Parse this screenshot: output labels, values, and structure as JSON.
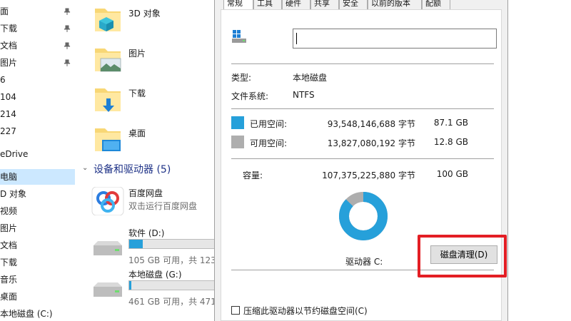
{
  "nav": {
    "items": [
      {
        "label": "面",
        "pinned": true
      },
      {
        "label": "下载",
        "pinned": true
      },
      {
        "label": "文档",
        "pinned": true
      },
      {
        "label": "图片",
        "pinned": true
      },
      {
        "label": "6",
        "pinned": false
      },
      {
        "label": "104",
        "pinned": false
      },
      {
        "label": "214",
        "pinned": false
      },
      {
        "label": "227",
        "pinned": false
      },
      {
        "label": "eDrive",
        "pinned": false
      },
      {
        "label": "电脑",
        "pinned": false,
        "selected": true
      },
      {
        "label": "D 对象",
        "pinned": false
      },
      {
        "label": "视频",
        "pinned": false
      },
      {
        "label": "图片",
        "pinned": false
      },
      {
        "label": "文档",
        "pinned": false
      },
      {
        "label": "下载",
        "pinned": false
      },
      {
        "label": "音乐",
        "pinned": false
      },
      {
        "label": "桌面",
        "pinned": false
      },
      {
        "label": "本地磁盘 (C:)",
        "pinned": false
      }
    ]
  },
  "files": {
    "folders": [
      {
        "label": "3D 对象",
        "icon": "3d-objects-folder-icon"
      },
      {
        "label": "图片",
        "icon": "pictures-folder-icon"
      },
      {
        "label": "下载",
        "icon": "downloads-folder-icon"
      },
      {
        "label": "桌面",
        "icon": "desktop-folder-icon"
      }
    ],
    "group_header": "设备和驱动器 (5)",
    "drives": [
      {
        "name": "百度网盘",
        "sub": "双击运行百度网盘",
        "icon": "baidu-netdisk-icon"
      },
      {
        "name": "软件 (D:)",
        "sub": "105 GB 可用，共 123",
        "usage": 0.15,
        "icon": "hard-drive-icon"
      },
      {
        "name": "本地磁盘 (G:)",
        "sub": "461 GB 可用，共 471",
        "usage": 0.02,
        "icon": "hard-drive-icon"
      }
    ]
  },
  "dialog": {
    "tabs": [
      {
        "label": "常规",
        "active": true
      },
      {
        "label": "工具",
        "active": false
      },
      {
        "label": "硬件",
        "active": false
      },
      {
        "label": "共享",
        "active": false
      },
      {
        "label": "安全",
        "active": false
      },
      {
        "label": "以前的版本",
        "active": false
      },
      {
        "label": "配额",
        "active": false
      }
    ],
    "name_value": "",
    "type_label": "类型:",
    "type_value": "本地磁盘",
    "fs_label": "文件系统:",
    "fs_value": "NTFS",
    "used": {
      "label": "已用空间:",
      "bytes": "93,548,146,688 字节",
      "size": "87.1 GB",
      "color": "#26a0da"
    },
    "free": {
      "label": "可用空间:",
      "bytes": "13,827,080,192 字节",
      "size": "12.8 GB",
      "color": "#aeaeae"
    },
    "capacity": {
      "label": "容量:",
      "bytes": "107,375,225,880 字节",
      "size": "100 GB"
    },
    "used_fraction": 0.871,
    "drive_label": "驱动器 C:",
    "clean_button": "磁盘清理(D)",
    "compress_label": "压缩此驱动器以节约磁盘空间(C)",
    "highlight_color": "#e31e24"
  }
}
